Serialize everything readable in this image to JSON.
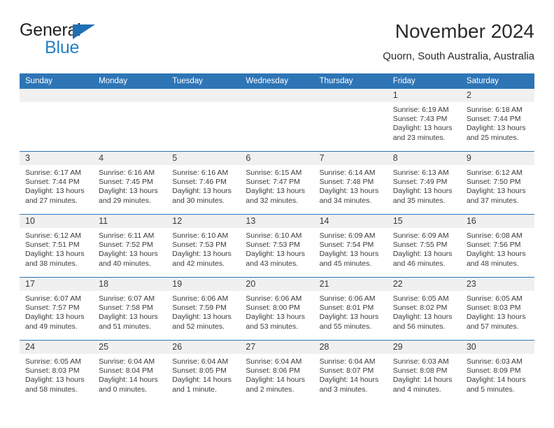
{
  "brand": {
    "line1": "General",
    "line2": "Blue",
    "triangle_color": "#1f6fb4",
    "blue_text_color": "#2481c4"
  },
  "header": {
    "title": "November 2024",
    "subtitle": "Quorn, South Australia, Australia"
  },
  "theme": {
    "header_blue": "#2e75b6",
    "daynum_band": "#f0f0f0",
    "text": "#3a3a3a"
  },
  "weekdays": [
    "Sunday",
    "Monday",
    "Tuesday",
    "Wednesday",
    "Thursday",
    "Friday",
    "Saturday"
  ],
  "weeks": [
    [
      {
        "day": "",
        "sunrise": "",
        "sunset": "",
        "daylight1": "",
        "daylight2": ""
      },
      {
        "day": "",
        "sunrise": "",
        "sunset": "",
        "daylight1": "",
        "daylight2": ""
      },
      {
        "day": "",
        "sunrise": "",
        "sunset": "",
        "daylight1": "",
        "daylight2": ""
      },
      {
        "day": "",
        "sunrise": "",
        "sunset": "",
        "daylight1": "",
        "daylight2": ""
      },
      {
        "day": "",
        "sunrise": "",
        "sunset": "",
        "daylight1": "",
        "daylight2": ""
      },
      {
        "day": "1",
        "sunrise": "Sunrise: 6:19 AM",
        "sunset": "Sunset: 7:43 PM",
        "daylight1": "Daylight: 13 hours",
        "daylight2": "and 23 minutes."
      },
      {
        "day": "2",
        "sunrise": "Sunrise: 6:18 AM",
        "sunset": "Sunset: 7:44 PM",
        "daylight1": "Daylight: 13 hours",
        "daylight2": "and 25 minutes."
      }
    ],
    [
      {
        "day": "3",
        "sunrise": "Sunrise: 6:17 AM",
        "sunset": "Sunset: 7:44 PM",
        "daylight1": "Daylight: 13 hours",
        "daylight2": "and 27 minutes."
      },
      {
        "day": "4",
        "sunrise": "Sunrise: 6:16 AM",
        "sunset": "Sunset: 7:45 PM",
        "daylight1": "Daylight: 13 hours",
        "daylight2": "and 29 minutes."
      },
      {
        "day": "5",
        "sunrise": "Sunrise: 6:16 AM",
        "sunset": "Sunset: 7:46 PM",
        "daylight1": "Daylight: 13 hours",
        "daylight2": "and 30 minutes."
      },
      {
        "day": "6",
        "sunrise": "Sunrise: 6:15 AM",
        "sunset": "Sunset: 7:47 PM",
        "daylight1": "Daylight: 13 hours",
        "daylight2": "and 32 minutes."
      },
      {
        "day": "7",
        "sunrise": "Sunrise: 6:14 AM",
        "sunset": "Sunset: 7:48 PM",
        "daylight1": "Daylight: 13 hours",
        "daylight2": "and 34 minutes."
      },
      {
        "day": "8",
        "sunrise": "Sunrise: 6:13 AM",
        "sunset": "Sunset: 7:49 PM",
        "daylight1": "Daylight: 13 hours",
        "daylight2": "and 35 minutes."
      },
      {
        "day": "9",
        "sunrise": "Sunrise: 6:12 AM",
        "sunset": "Sunset: 7:50 PM",
        "daylight1": "Daylight: 13 hours",
        "daylight2": "and 37 minutes."
      }
    ],
    [
      {
        "day": "10",
        "sunrise": "Sunrise: 6:12 AM",
        "sunset": "Sunset: 7:51 PM",
        "daylight1": "Daylight: 13 hours",
        "daylight2": "and 38 minutes."
      },
      {
        "day": "11",
        "sunrise": "Sunrise: 6:11 AM",
        "sunset": "Sunset: 7:52 PM",
        "daylight1": "Daylight: 13 hours",
        "daylight2": "and 40 minutes."
      },
      {
        "day": "12",
        "sunrise": "Sunrise: 6:10 AM",
        "sunset": "Sunset: 7:53 PM",
        "daylight1": "Daylight: 13 hours",
        "daylight2": "and 42 minutes."
      },
      {
        "day": "13",
        "sunrise": "Sunrise: 6:10 AM",
        "sunset": "Sunset: 7:53 PM",
        "daylight1": "Daylight: 13 hours",
        "daylight2": "and 43 minutes."
      },
      {
        "day": "14",
        "sunrise": "Sunrise: 6:09 AM",
        "sunset": "Sunset: 7:54 PM",
        "daylight1": "Daylight: 13 hours",
        "daylight2": "and 45 minutes."
      },
      {
        "day": "15",
        "sunrise": "Sunrise: 6:09 AM",
        "sunset": "Sunset: 7:55 PM",
        "daylight1": "Daylight: 13 hours",
        "daylight2": "and 46 minutes."
      },
      {
        "day": "16",
        "sunrise": "Sunrise: 6:08 AM",
        "sunset": "Sunset: 7:56 PM",
        "daylight1": "Daylight: 13 hours",
        "daylight2": "and 48 minutes."
      }
    ],
    [
      {
        "day": "17",
        "sunrise": "Sunrise: 6:07 AM",
        "sunset": "Sunset: 7:57 PM",
        "daylight1": "Daylight: 13 hours",
        "daylight2": "and 49 minutes."
      },
      {
        "day": "18",
        "sunrise": "Sunrise: 6:07 AM",
        "sunset": "Sunset: 7:58 PM",
        "daylight1": "Daylight: 13 hours",
        "daylight2": "and 51 minutes."
      },
      {
        "day": "19",
        "sunrise": "Sunrise: 6:06 AM",
        "sunset": "Sunset: 7:59 PM",
        "daylight1": "Daylight: 13 hours",
        "daylight2": "and 52 minutes."
      },
      {
        "day": "20",
        "sunrise": "Sunrise: 6:06 AM",
        "sunset": "Sunset: 8:00 PM",
        "daylight1": "Daylight: 13 hours",
        "daylight2": "and 53 minutes."
      },
      {
        "day": "21",
        "sunrise": "Sunrise: 6:06 AM",
        "sunset": "Sunset: 8:01 PM",
        "daylight1": "Daylight: 13 hours",
        "daylight2": "and 55 minutes."
      },
      {
        "day": "22",
        "sunrise": "Sunrise: 6:05 AM",
        "sunset": "Sunset: 8:02 PM",
        "daylight1": "Daylight: 13 hours",
        "daylight2": "and 56 minutes."
      },
      {
        "day": "23",
        "sunrise": "Sunrise: 6:05 AM",
        "sunset": "Sunset: 8:03 PM",
        "daylight1": "Daylight: 13 hours",
        "daylight2": "and 57 minutes."
      }
    ],
    [
      {
        "day": "24",
        "sunrise": "Sunrise: 6:05 AM",
        "sunset": "Sunset: 8:03 PM",
        "daylight1": "Daylight: 13 hours",
        "daylight2": "and 58 minutes."
      },
      {
        "day": "25",
        "sunrise": "Sunrise: 6:04 AM",
        "sunset": "Sunset: 8:04 PM",
        "daylight1": "Daylight: 14 hours",
        "daylight2": "and 0 minutes."
      },
      {
        "day": "26",
        "sunrise": "Sunrise: 6:04 AM",
        "sunset": "Sunset: 8:05 PM",
        "daylight1": "Daylight: 14 hours",
        "daylight2": "and 1 minute."
      },
      {
        "day": "27",
        "sunrise": "Sunrise: 6:04 AM",
        "sunset": "Sunset: 8:06 PM",
        "daylight1": "Daylight: 14 hours",
        "daylight2": "and 2 minutes."
      },
      {
        "day": "28",
        "sunrise": "Sunrise: 6:04 AM",
        "sunset": "Sunset: 8:07 PM",
        "daylight1": "Daylight: 14 hours",
        "daylight2": "and 3 minutes."
      },
      {
        "day": "29",
        "sunrise": "Sunrise: 6:03 AM",
        "sunset": "Sunset: 8:08 PM",
        "daylight1": "Daylight: 14 hours",
        "daylight2": "and 4 minutes."
      },
      {
        "day": "30",
        "sunrise": "Sunrise: 6:03 AM",
        "sunset": "Sunset: 8:09 PM",
        "daylight1": "Daylight: 14 hours",
        "daylight2": "and 5 minutes."
      }
    ]
  ]
}
